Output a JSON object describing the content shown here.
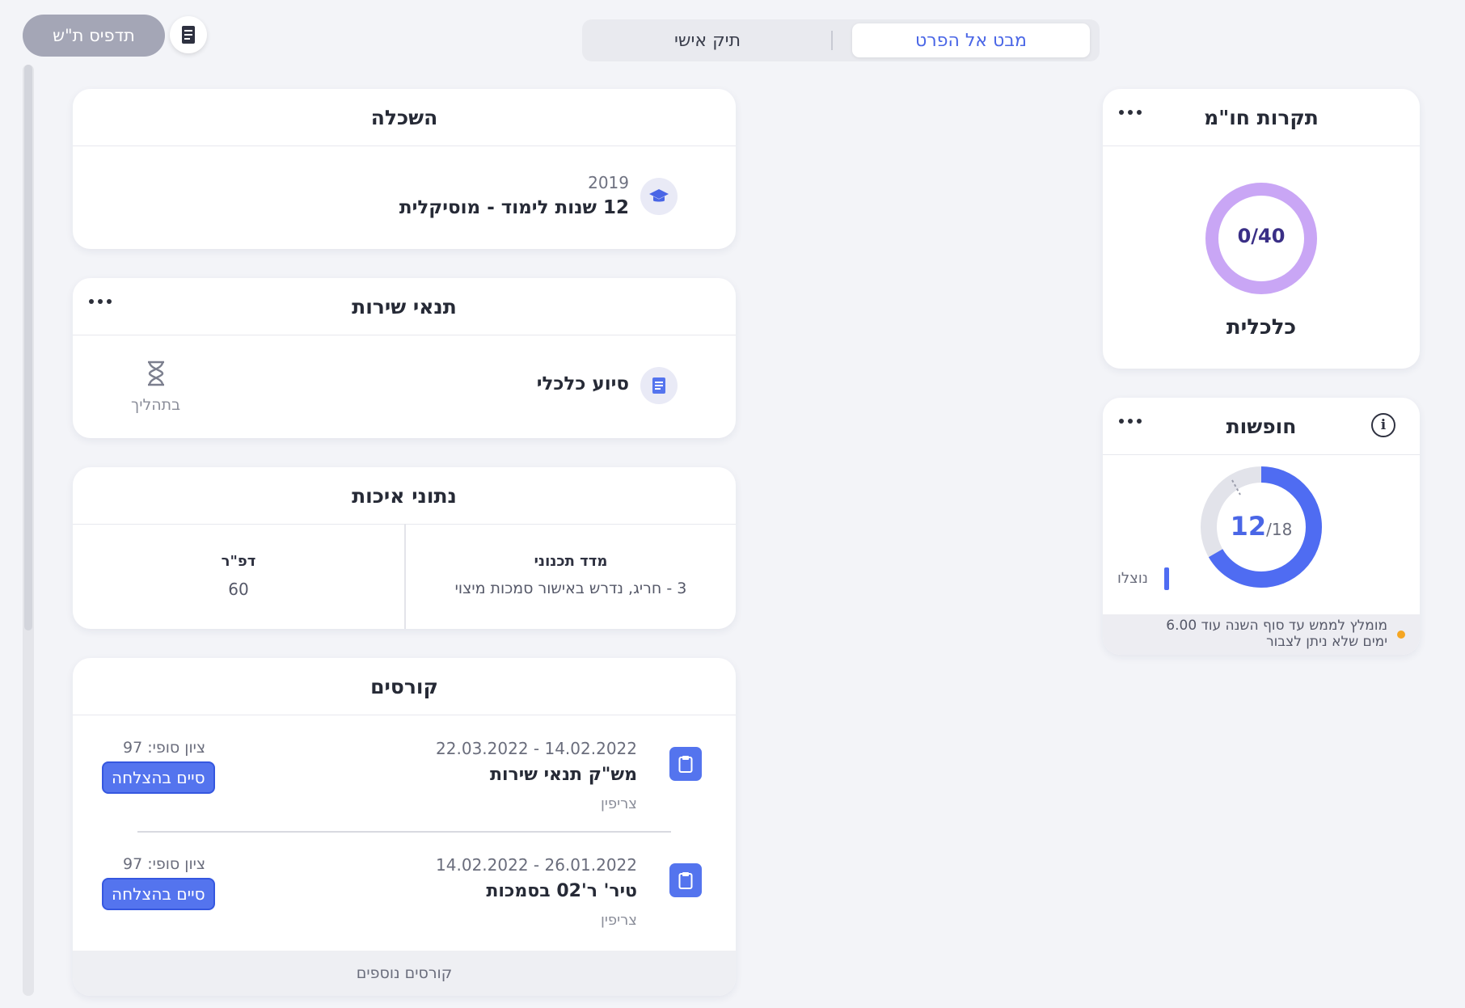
{
  "toolbar": {
    "print_label": "תדפיס ת\"ש",
    "print_icon": "document-icon"
  },
  "view_tabs": {
    "items": [
      {
        "label": "תיק אישי",
        "active": false
      },
      {
        "label": "מבט אל הפרט",
        "active": true
      }
    ]
  },
  "education": {
    "title": "השכלה",
    "year": "2019",
    "description": "12 שנות לימוד - מוסיקלית",
    "icon": "graduation-cap-icon"
  },
  "service_conditions": {
    "title": "תנאי שירות",
    "item_label": "סיוע כלכלי",
    "status_label": "בתהליך",
    "item_icon": "document-icon",
    "status_icon": "hourglass-icon"
  },
  "quality_data": {
    "title": "נתוני איכות",
    "columns": [
      {
        "label": "מדד תכנוני",
        "value": "3 - חריג, נדרש באישור סמכות מיצוי"
      },
      {
        "label": "דפ\"ר",
        "value": "60"
      }
    ]
  },
  "courses": {
    "title": "קורסים",
    "more_label": "קורסים נוספים",
    "items": [
      {
        "dates": "14.02.2022 - 22.03.2022",
        "name": "מש\"ק תנאי שירות",
        "location": "צריפין",
        "grade": "ציון סופי: 97",
        "status": "סיים בהצלחה"
      },
      {
        "dates": "26.01.2022 - 14.02.2022",
        "name": "טיר' ר'02 בסמכות",
        "location": "צריפין",
        "grade": "ציון סופי: 97",
        "status": "סיים בהצלחה"
      }
    ]
  },
  "quotas": {
    "title": "תקרות חו\"מ",
    "value": "0/40",
    "used": 0,
    "total": 40,
    "label": "כלכלית"
  },
  "vacations": {
    "title": "חופשות",
    "value_main": "12",
    "value_total": "/18",
    "fraction_used": 0.667,
    "legend_label": "נוצלו",
    "footnote_line1": "מומלץ לממש עד סוף השנה עוד 6.00",
    "footnote_line2": "ימים שלא ניתן לצבור"
  },
  "colors": {
    "accent": "#5474ee",
    "quota_ring": "#c9a6f5",
    "background": "#f3f4f8",
    "warning_dot": "#f5a623"
  }
}
